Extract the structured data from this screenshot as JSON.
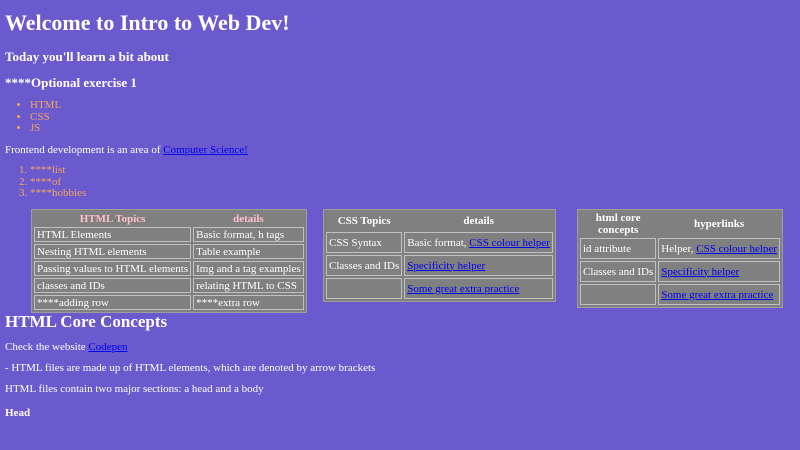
{
  "header": {
    "title": "Welcome to Intro to Web Dev!",
    "subtitle": "Today you'll learn a bit about",
    "exercise": "****Optional exercise 1"
  },
  "topics_list": [
    "HTML",
    "CSS",
    "JS"
  ],
  "frontend": {
    "text": "Frontend development is an area of ",
    "link": "Computer Science!"
  },
  "ordered_list": [
    "****list",
    "****of",
    "****hobbies"
  ],
  "html_table": {
    "headers": [
      "HTML Topics",
      "details"
    ],
    "rows": [
      [
        "HTML Elements",
        "Basic format, h tags"
      ],
      [
        "Nesting HTML elements",
        "Table example"
      ],
      [
        "Passing values to HTML elements",
        "Img and a tag examples"
      ],
      [
        "classes and IDs",
        "relating HTML to CSS"
      ],
      [
        "****adding row",
        "****extra row"
      ]
    ]
  },
  "css_table": {
    "headers": [
      "CSS Topics",
      "details"
    ],
    "rows": [
      {
        "topic": "CSS Syntax",
        "text": "Basic format, ",
        "link": "CSS colour helper"
      },
      {
        "topic": "Classes and IDs",
        "text": "",
        "link": "Specificity helper"
      },
      {
        "topic": "",
        "text": "",
        "link": "Some great extra practice"
      }
    ]
  },
  "core_table": {
    "headers": [
      "html core concepts",
      "hyperlinks"
    ],
    "rows": [
      {
        "topic": "id attribute",
        "text": "Helper, ",
        "link": "CSS colour helper"
      },
      {
        "topic": "Classes and IDs",
        "text": "",
        "link": "Specificity helper"
      },
      {
        "topic": "",
        "text": "",
        "link": "Some great extra practice"
      }
    ]
  },
  "core_concepts": {
    "heading": "HTML Core Concepts",
    "check_text": "Check the website ",
    "check_link": "Codepen",
    "line1": "- HTML files are made up of HTML elements, which are denoted by arrow brackets",
    "line2": "HTML files contain two major sections: a head and a body",
    "head_label": "Head"
  },
  "colors": {
    "background": "#6a5acd",
    "list_text": "#f4a460",
    "table_bg": "#808080",
    "html_header_text": "#ffc0cb",
    "link": "#0000ee"
  }
}
